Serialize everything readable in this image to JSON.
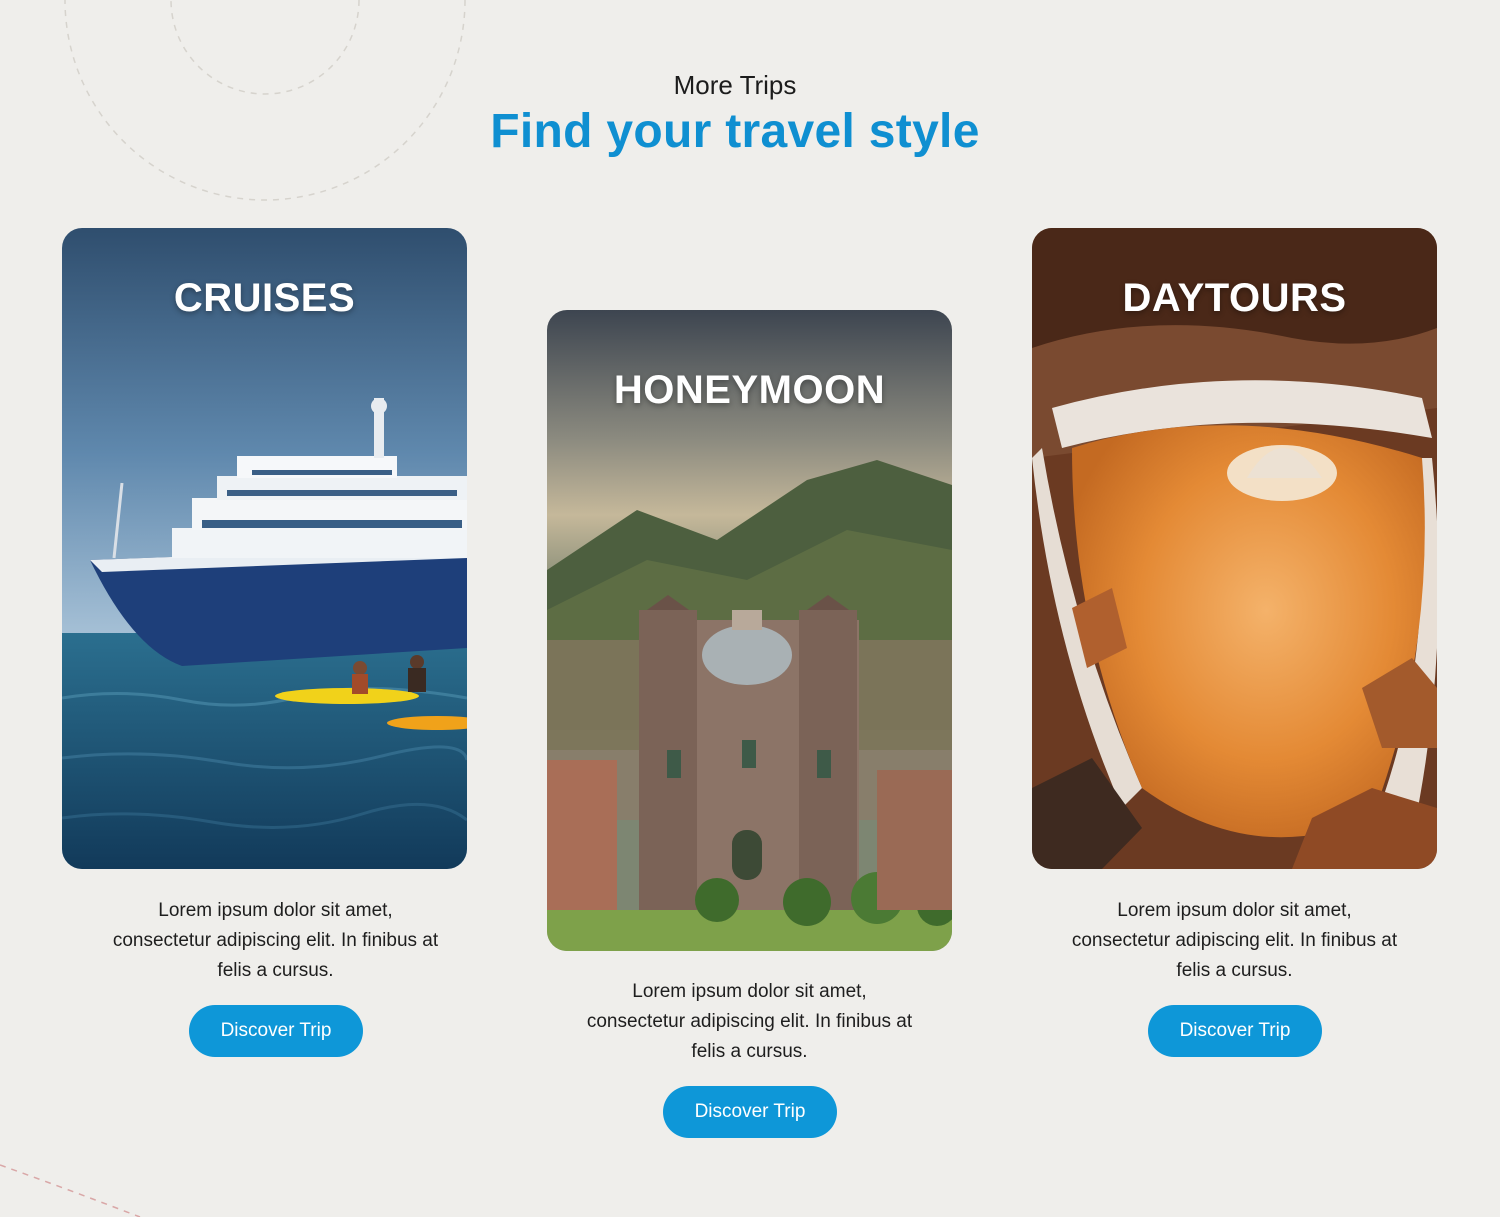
{
  "section": {
    "eyebrow": "More Trips",
    "headline": "Find your travel style"
  },
  "cards": [
    {
      "title": "CRUISES",
      "description_lines": [
        "Lorem ipsum dolor sit amet,",
        "consectetur adipiscing elit. In finibus at",
        "felis a cursus."
      ],
      "button_label": "Discover Trip",
      "image": "cruise-ship-photo"
    },
    {
      "title": "HONEYMOON",
      "description_lines": [
        "Lorem ipsum dolor sit amet,",
        "consectetur adipiscing elit. In finibus at",
        "felis a cursus."
      ],
      "button_label": "Discover Trip",
      "image": "cathedral-city-photo"
    },
    {
      "title": "DAYTOURS",
      "description_lines": [
        "Lorem ipsum dolor sit amet,",
        "consectetur adipiscing elit. In finibus at",
        "felis a cursus."
      ],
      "button_label": "Discover Trip",
      "image": "salt-ponds-photo"
    }
  ],
  "colors": {
    "background": "#efeeeb",
    "accent": "#0f8fd1",
    "button": "#0e97d8",
    "text": "#1e1e1e"
  }
}
